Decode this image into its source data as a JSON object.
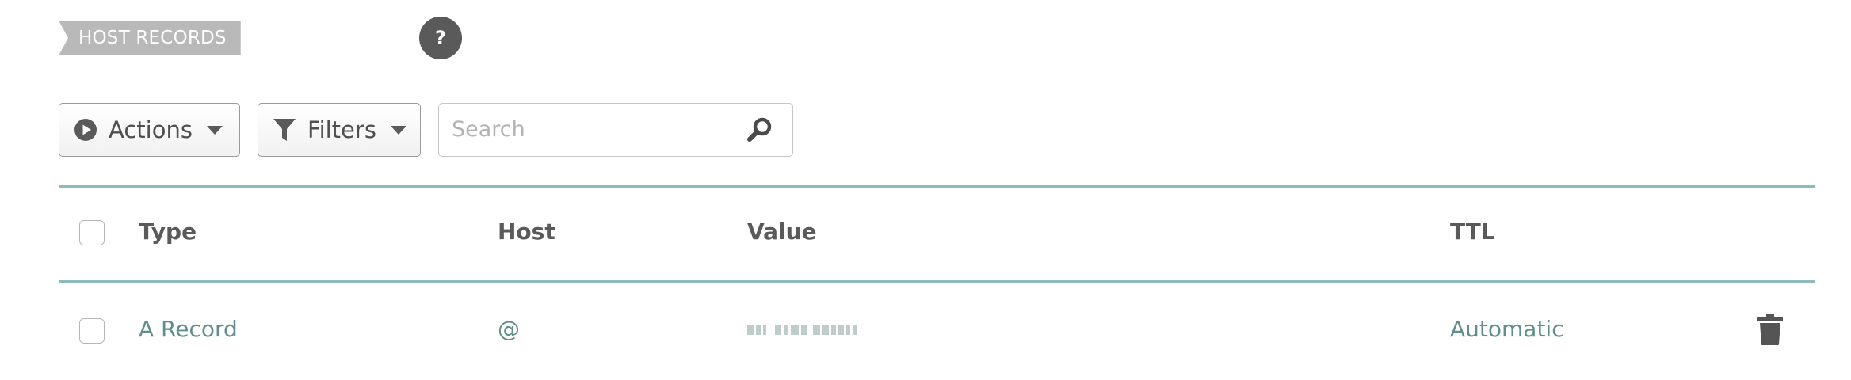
{
  "section": {
    "label": "HOST RECORDS",
    "help_label": "?"
  },
  "toolbar": {
    "actions_label": "Actions",
    "filters_label": "Filters",
    "search_placeholder": "Search",
    "icons": [
      "play-circle-icon",
      "funnel-icon",
      "search-icon"
    ]
  },
  "table": {
    "columns": [
      "Type",
      "Host",
      "Value",
      "TTL"
    ],
    "rows": [
      {
        "type": "A Record",
        "host": "@",
        "value": "",
        "ttl": "Automatic",
        "action_icon": "trash-icon"
      }
    ]
  },
  "colors": {
    "accent_rule": "#8cbcbc",
    "link_text": "#5f8f8c",
    "label_bg": "#b9b9b9",
    "help_bg": "#5a5a5a"
  }
}
